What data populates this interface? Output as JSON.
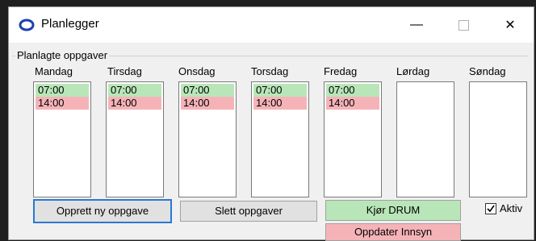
{
  "window": {
    "title": "Planlegger",
    "controls": {
      "minimize": "—",
      "close": "✕"
    }
  },
  "group": {
    "label": "Planlagte oppgaver"
  },
  "days": [
    {
      "label": "Mandag",
      "items": [
        {
          "time": "07:00",
          "status": "green"
        },
        {
          "time": "14:00",
          "status": "pink"
        }
      ]
    },
    {
      "label": "Tirsdag",
      "items": [
        {
          "time": "07:00",
          "status": "green"
        },
        {
          "time": "14:00",
          "status": "pink"
        }
      ]
    },
    {
      "label": "Onsdag",
      "items": [
        {
          "time": "07:00",
          "status": "green"
        },
        {
          "time": "14:00",
          "status": "pink"
        }
      ]
    },
    {
      "label": "Torsdag",
      "items": [
        {
          "time": "07:00",
          "status": "green"
        },
        {
          "time": "14:00",
          "status": "pink"
        }
      ]
    },
    {
      "label": "Fredag",
      "items": [
        {
          "time": "07:00",
          "status": "green"
        },
        {
          "time": "14:00",
          "status": "pink"
        }
      ]
    },
    {
      "label": "Lørdag",
      "items": []
    },
    {
      "label": "Søndag",
      "items": []
    }
  ],
  "buttons": {
    "create": "Opprett ny oppgave",
    "delete": "Slett oppgaver",
    "run_drum": "Kjør DRUM",
    "update_insight": "Oppdater Innsyn"
  },
  "checkbox": {
    "label": "Aktiv",
    "checked": true
  },
  "colors": {
    "green": "#b9e6b9",
    "pink": "#f5b3b8",
    "focus": "#2a78d4"
  }
}
